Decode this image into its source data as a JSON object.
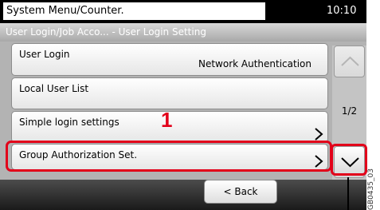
{
  "header": {
    "title": "System Menu/Counter.",
    "time": "10:10"
  },
  "breadcrumb": "User Login/Job Acco... - User Login Setting",
  "menu": {
    "items": [
      {
        "label": "User Login",
        "value": "Network Authentication"
      },
      {
        "label": "Local User List"
      },
      {
        "label": "Simple login settings"
      },
      {
        "label": "Group Authorization Set."
      }
    ]
  },
  "pagination": {
    "indicator": "1/2"
  },
  "footer": {
    "back_label": "< Back"
  },
  "callout": {
    "step": "1"
  },
  "figure_code": "GB0435_03",
  "colors": {
    "highlight": "#e2001a"
  },
  "icons": [
    "chevron-right-icon",
    "scroll-up-icon",
    "scroll-down-icon"
  ]
}
